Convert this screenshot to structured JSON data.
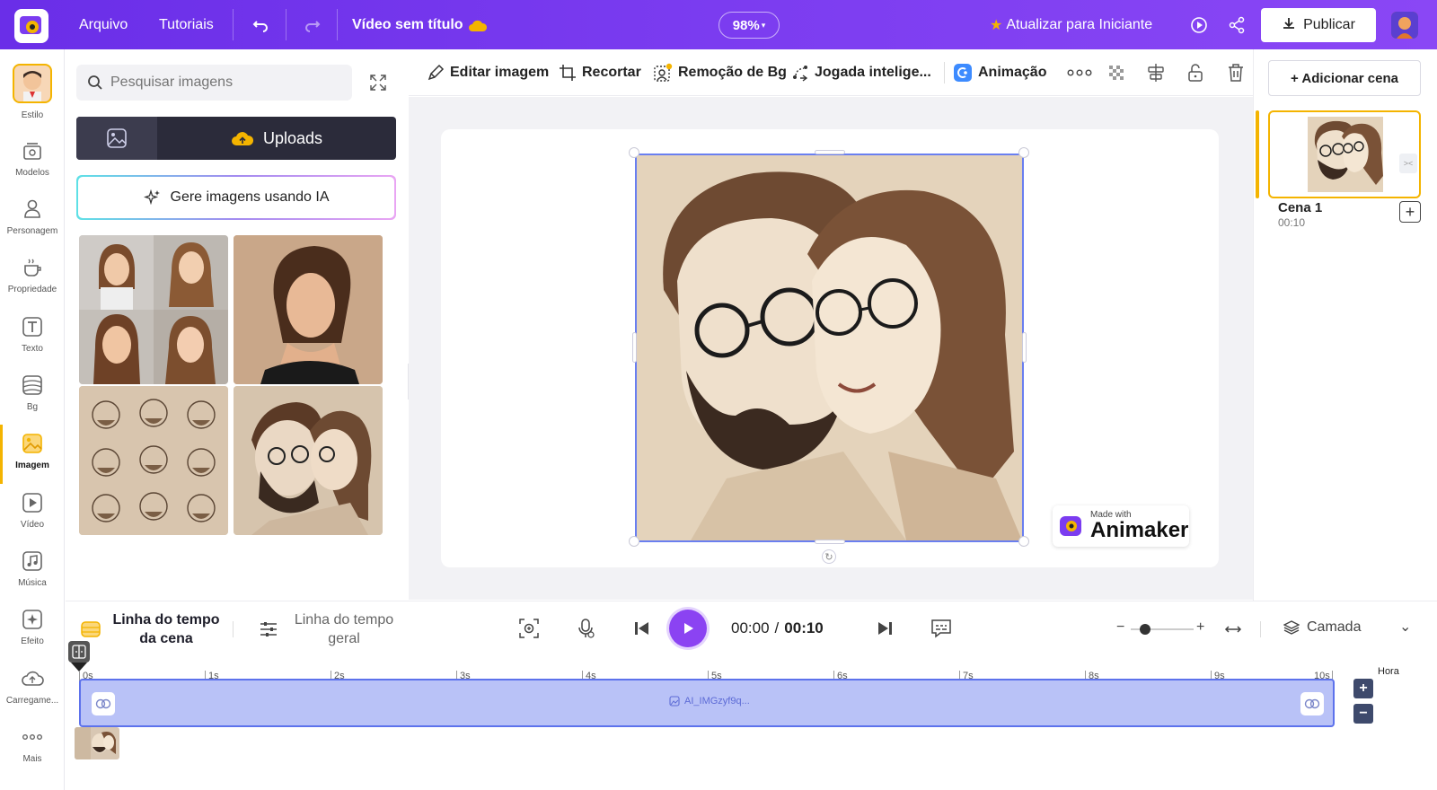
{
  "topbar": {
    "menu_file": "Arquivo",
    "menu_tutorials": "Tutoriais",
    "video_title": "Vídeo sem título",
    "zoom": "98%",
    "upgrade": "Atualizar para Iniciante",
    "publish": "Publicar"
  },
  "sidebar": {
    "items": [
      {
        "label": "Estilo",
        "icon": "avatar-style-icon"
      },
      {
        "label": "Modelos",
        "icon": "templates-icon"
      },
      {
        "label": "Personagem",
        "icon": "character-icon"
      },
      {
        "label": "Propriedade",
        "icon": "property-cup-icon"
      },
      {
        "label": "Texto",
        "icon": "text-icon"
      },
      {
        "label": "Bg",
        "icon": "background-icon"
      },
      {
        "label": "Imagem",
        "icon": "image-icon",
        "active": true
      },
      {
        "label": "Vídeo",
        "icon": "video-icon"
      },
      {
        "label": "Música",
        "icon": "music-icon"
      },
      {
        "label": "Efeito",
        "icon": "effect-icon"
      },
      {
        "label": "Carregame...",
        "icon": "upload-cloud-icon"
      },
      {
        "label": "Mais",
        "icon": "more-icon"
      }
    ]
  },
  "panel": {
    "search_placeholder": "Pesquisar imagens",
    "tab_uploads": "Uploads",
    "generate_ai": "Gere imagens usando IA"
  },
  "toolbar": {
    "edit_image": "Editar imagem",
    "crop": "Recortar",
    "bg_removal": "Remoção de Bg",
    "smart_move": "Jogada intelige...",
    "animation": "Animação"
  },
  "canvas": {
    "watermark_small": "Made with",
    "watermark_brand": "Animaker"
  },
  "right_panel": {
    "add_scene": "+ Adicionar cena",
    "scene_name": "Cena 1",
    "scene_duration": "00:10"
  },
  "timeline": {
    "tab_scene": "Linha do tempo da cena",
    "tab_global": "Linha do tempo geral",
    "time_current": "00:00",
    "time_separator": "/",
    "time_total": "00:10",
    "layer": "Camada",
    "hour_label": "Hora",
    "ruler_ticks": [
      "0s",
      "1s",
      "2s",
      "3s",
      "4s",
      "5s",
      "6s",
      "7s",
      "8s",
      "9s",
      "10s"
    ],
    "track_label": "AI_IMGzyf9q..."
  },
  "colors": {
    "brand_purple": "#7b3cf0",
    "accent_yellow": "#f4b400",
    "track_fill": "#b9c2f7",
    "track_border": "#5d72ec"
  }
}
